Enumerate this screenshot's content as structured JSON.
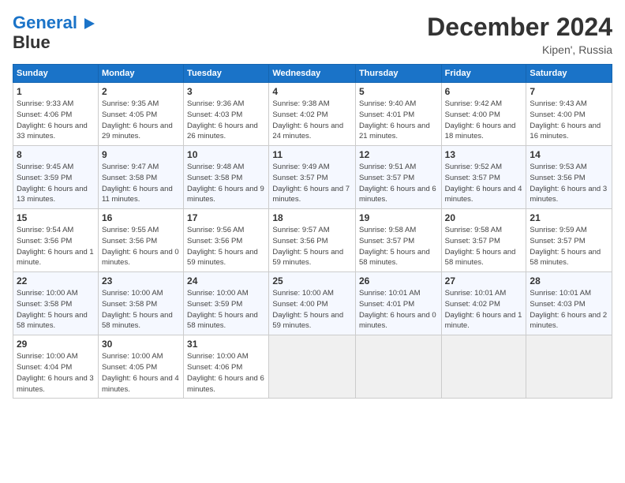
{
  "header": {
    "logo_line1": "General",
    "logo_line2": "Blue",
    "month_year": "December 2024",
    "location": "Kipen', Russia"
  },
  "days_of_week": [
    "Sunday",
    "Monday",
    "Tuesday",
    "Wednesday",
    "Thursday",
    "Friday",
    "Saturday"
  ],
  "weeks": [
    [
      {
        "day": "1",
        "info": "Sunrise: 9:33 AM\nSunset: 4:06 PM\nDaylight: 6 hours and 33 minutes."
      },
      {
        "day": "2",
        "info": "Sunrise: 9:35 AM\nSunset: 4:05 PM\nDaylight: 6 hours and 29 minutes."
      },
      {
        "day": "3",
        "info": "Sunrise: 9:36 AM\nSunset: 4:03 PM\nDaylight: 6 hours and 26 minutes."
      },
      {
        "day": "4",
        "info": "Sunrise: 9:38 AM\nSunset: 4:02 PM\nDaylight: 6 hours and 24 minutes."
      },
      {
        "day": "5",
        "info": "Sunrise: 9:40 AM\nSunset: 4:01 PM\nDaylight: 6 hours and 21 minutes."
      },
      {
        "day": "6",
        "info": "Sunrise: 9:42 AM\nSunset: 4:00 PM\nDaylight: 6 hours and 18 minutes."
      },
      {
        "day": "7",
        "info": "Sunrise: 9:43 AM\nSunset: 4:00 PM\nDaylight: 6 hours and 16 minutes."
      }
    ],
    [
      {
        "day": "8",
        "info": "Sunrise: 9:45 AM\nSunset: 3:59 PM\nDaylight: 6 hours and 13 minutes."
      },
      {
        "day": "9",
        "info": "Sunrise: 9:47 AM\nSunset: 3:58 PM\nDaylight: 6 hours and 11 minutes."
      },
      {
        "day": "10",
        "info": "Sunrise: 9:48 AM\nSunset: 3:58 PM\nDaylight: 6 hours and 9 minutes."
      },
      {
        "day": "11",
        "info": "Sunrise: 9:49 AM\nSunset: 3:57 PM\nDaylight: 6 hours and 7 minutes."
      },
      {
        "day": "12",
        "info": "Sunrise: 9:51 AM\nSunset: 3:57 PM\nDaylight: 6 hours and 6 minutes."
      },
      {
        "day": "13",
        "info": "Sunrise: 9:52 AM\nSunset: 3:57 PM\nDaylight: 6 hours and 4 minutes."
      },
      {
        "day": "14",
        "info": "Sunrise: 9:53 AM\nSunset: 3:56 PM\nDaylight: 6 hours and 3 minutes."
      }
    ],
    [
      {
        "day": "15",
        "info": "Sunrise: 9:54 AM\nSunset: 3:56 PM\nDaylight: 6 hours and 1 minute."
      },
      {
        "day": "16",
        "info": "Sunrise: 9:55 AM\nSunset: 3:56 PM\nDaylight: 6 hours and 0 minutes."
      },
      {
        "day": "17",
        "info": "Sunrise: 9:56 AM\nSunset: 3:56 PM\nDaylight: 5 hours and 59 minutes."
      },
      {
        "day": "18",
        "info": "Sunrise: 9:57 AM\nSunset: 3:56 PM\nDaylight: 5 hours and 59 minutes."
      },
      {
        "day": "19",
        "info": "Sunrise: 9:58 AM\nSunset: 3:57 PM\nDaylight: 5 hours and 58 minutes."
      },
      {
        "day": "20",
        "info": "Sunrise: 9:58 AM\nSunset: 3:57 PM\nDaylight: 5 hours and 58 minutes."
      },
      {
        "day": "21",
        "info": "Sunrise: 9:59 AM\nSunset: 3:57 PM\nDaylight: 5 hours and 58 minutes."
      }
    ],
    [
      {
        "day": "22",
        "info": "Sunrise: 10:00 AM\nSunset: 3:58 PM\nDaylight: 5 hours and 58 minutes."
      },
      {
        "day": "23",
        "info": "Sunrise: 10:00 AM\nSunset: 3:58 PM\nDaylight: 5 hours and 58 minutes."
      },
      {
        "day": "24",
        "info": "Sunrise: 10:00 AM\nSunset: 3:59 PM\nDaylight: 5 hours and 58 minutes."
      },
      {
        "day": "25",
        "info": "Sunrise: 10:00 AM\nSunset: 4:00 PM\nDaylight: 5 hours and 59 minutes."
      },
      {
        "day": "26",
        "info": "Sunrise: 10:01 AM\nSunset: 4:01 PM\nDaylight: 6 hours and 0 minutes."
      },
      {
        "day": "27",
        "info": "Sunrise: 10:01 AM\nSunset: 4:02 PM\nDaylight: 6 hours and 1 minute."
      },
      {
        "day": "28",
        "info": "Sunrise: 10:01 AM\nSunset: 4:03 PM\nDaylight: 6 hours and 2 minutes."
      }
    ],
    [
      {
        "day": "29",
        "info": "Sunrise: 10:00 AM\nSunset: 4:04 PM\nDaylight: 6 hours and 3 minutes."
      },
      {
        "day": "30",
        "info": "Sunrise: 10:00 AM\nSunset: 4:05 PM\nDaylight: 6 hours and 4 minutes."
      },
      {
        "day": "31",
        "info": "Sunrise: 10:00 AM\nSunset: 4:06 PM\nDaylight: 6 hours and 6 minutes."
      },
      null,
      null,
      null,
      null
    ]
  ]
}
